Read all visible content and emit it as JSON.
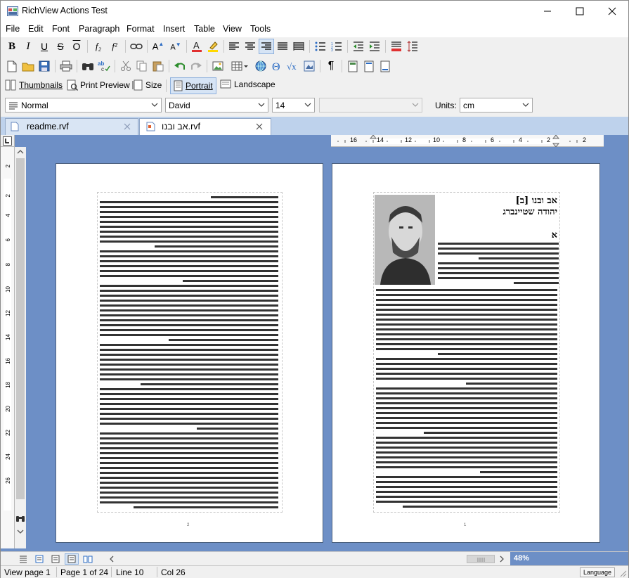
{
  "window": {
    "title": "RichView Actions Test"
  },
  "menu": [
    "File",
    "Edit",
    "Font",
    "Paragraph",
    "Format",
    "Insert",
    "Table",
    "View",
    "Tools"
  ],
  "toolbar_view": {
    "thumbnails": "Thumbnails",
    "print_preview": "Print Preview",
    "size": "Size",
    "portrait": "Portrait",
    "landscape": "Landscape"
  },
  "format_bar": {
    "style": "Normal",
    "font": "David",
    "size": "14",
    "extra": "",
    "units_label": "Units:",
    "units": "cm"
  },
  "tabs": [
    {
      "label": "readme.rvf",
      "active": false
    },
    {
      "label": "אב ובנו.rvf",
      "active": true
    }
  ],
  "ruler": {
    "h_labels": [
      "16",
      "14",
      "12",
      "10",
      "8",
      "6",
      "4",
      "2",
      "2"
    ],
    "v_labels": [
      "2",
      "2",
      "4",
      "6",
      "8",
      "10",
      "12",
      "14",
      "16",
      "18",
      "20",
      "22",
      "24",
      "26"
    ]
  },
  "pages": {
    "left_page_number": "2",
    "right_page_number": "1",
    "right_title_1": "אב ובנו [ב]",
    "right_title_2": "יהודה שטיינברג",
    "right_heading": "א"
  },
  "zoom": "48%",
  "status": {
    "view_page": "View page 1",
    "page_of": "Page 1 of 24",
    "line": "Line 10",
    "col": "Col 26",
    "language": "Language"
  },
  "colors": {
    "workspace": "#6d8fc6",
    "tabbar": "#bed2ec",
    "accent": "#2b6cc4"
  }
}
